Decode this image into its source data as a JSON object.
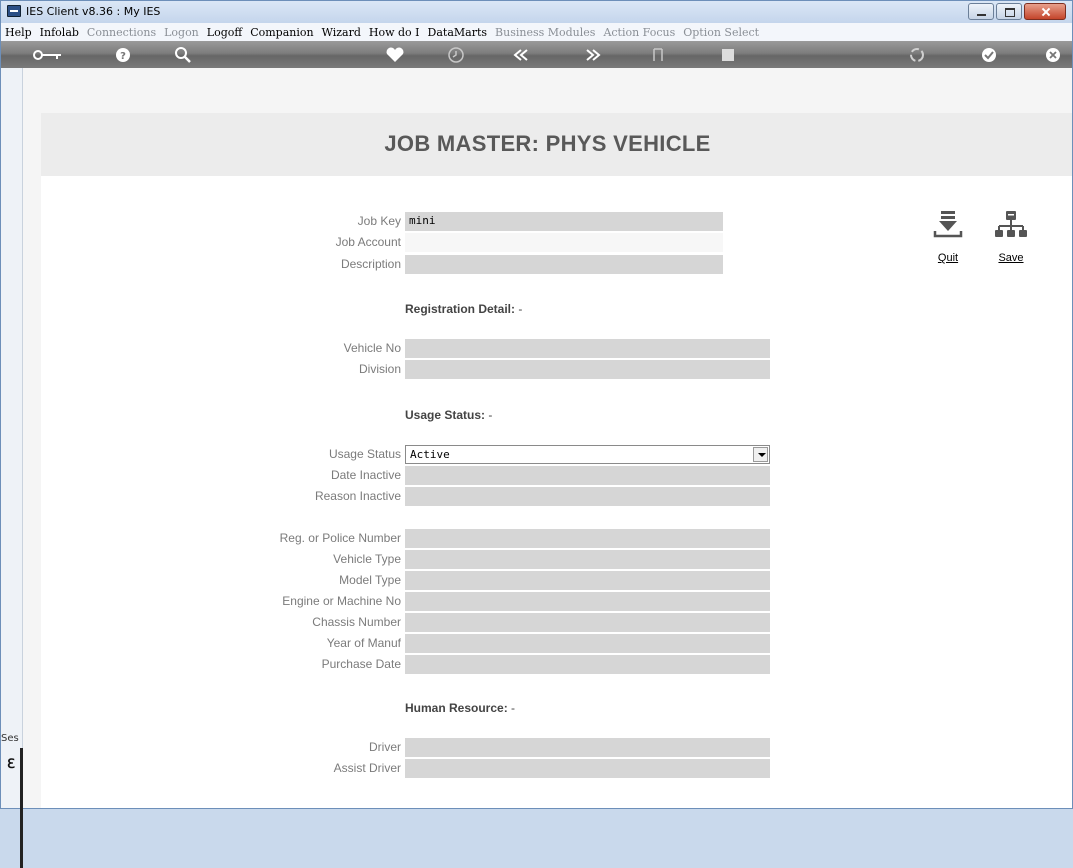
{
  "window": {
    "title": "IES Client v8.36 : My IES"
  },
  "menu": [
    {
      "label": "Help",
      "enabled": true
    },
    {
      "label": "Infolab",
      "enabled": true
    },
    {
      "label": "Connections",
      "enabled": false
    },
    {
      "label": "Logon",
      "enabled": false
    },
    {
      "label": "Logoff",
      "enabled": true
    },
    {
      "label": "Companion",
      "enabled": true
    },
    {
      "label": "Wizard",
      "enabled": true
    },
    {
      "label": "How do I",
      "enabled": true
    },
    {
      "label": "DataMarts",
      "enabled": true
    },
    {
      "label": "Business Modules",
      "enabled": false
    },
    {
      "label": "Action Focus",
      "enabled": false
    },
    {
      "label": "Option Select",
      "enabled": false
    }
  ],
  "toolbar_icons": [
    "key-icon",
    "help-icon",
    "search-icon",
    "heart-icon",
    "clock-icon",
    "back-icon",
    "forward-icon",
    "tree-icon",
    "stop-icon",
    "recycle-icon",
    "check-icon",
    "close-icon"
  ],
  "side": {
    "session_label": "Ses"
  },
  "page": {
    "title": "JOB MASTER: PHYS VEHICLE",
    "fields": {
      "job_key": {
        "label": "Job Key",
        "value": "mini"
      },
      "job_account": {
        "label": "Job Account",
        "value": ""
      },
      "description": {
        "label": "Description",
        "value": ""
      },
      "vehicle_no": {
        "label": "Vehicle No",
        "value": ""
      },
      "division": {
        "label": "Division",
        "value": ""
      },
      "usage_status": {
        "label": "Usage Status",
        "value": "Active"
      },
      "date_inactive": {
        "label": "Date Inactive",
        "value": ""
      },
      "reason_inactive": {
        "label": "Reason Inactive",
        "value": ""
      },
      "reg_number": {
        "label": "Reg. or Police Number",
        "value": ""
      },
      "vehicle_type": {
        "label": "Vehicle Type",
        "value": ""
      },
      "model_type": {
        "label": "Model Type",
        "value": ""
      },
      "engine_no": {
        "label": "Engine or Machine No",
        "value": ""
      },
      "chassis_number": {
        "label": "Chassis Number",
        "value": ""
      },
      "year_of_manuf": {
        "label": "Year of Manuf",
        "value": ""
      },
      "purchase_date": {
        "label": "Purchase Date",
        "value": ""
      },
      "driver": {
        "label": "Driver",
        "value": ""
      },
      "assist_driver": {
        "label": "Assist Driver",
        "value": ""
      }
    },
    "sections": {
      "registration": {
        "label": "Registration Detail:",
        "suffix": "-"
      },
      "usage": {
        "label": "Usage Status:",
        "suffix": "-"
      },
      "human": {
        "label": "Human Resource:",
        "suffix": "-"
      }
    },
    "actions": {
      "quit": "Quit",
      "save": "Save"
    }
  }
}
